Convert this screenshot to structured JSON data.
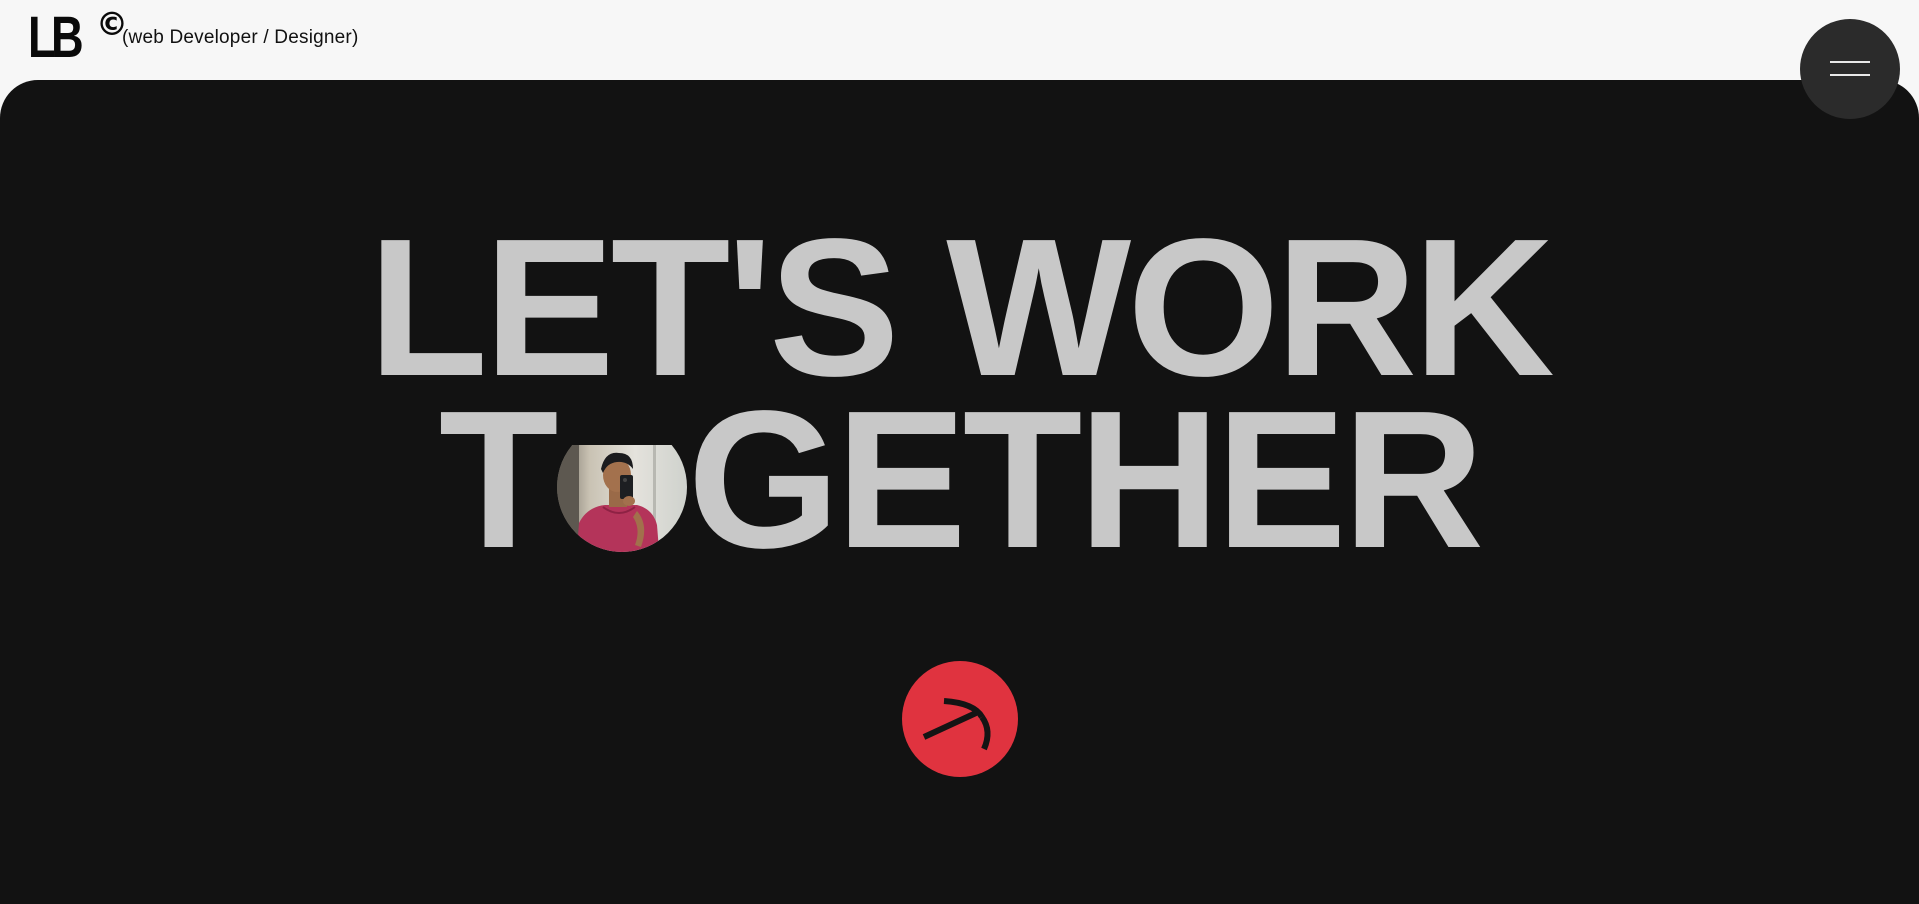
{
  "header": {
    "logo_text": "LB",
    "logo_mark": "©",
    "tagline": "(web Developer / Designer)"
  },
  "menu": {
    "icon": "hamburger-menu-icon"
  },
  "hero": {
    "line1": "LET'S WORK",
    "line2_before": "T",
    "line2_after": "GETHER",
    "avatar_alt": "profile-photo",
    "cta_icon": "arrow-up-right-icon"
  },
  "colors": {
    "page_bg": "#f7f7f7",
    "hero_bg": "#121212",
    "headline": "#c8c8c8",
    "menu_bg": "#2b2b2b",
    "accent": "#e0333f"
  }
}
